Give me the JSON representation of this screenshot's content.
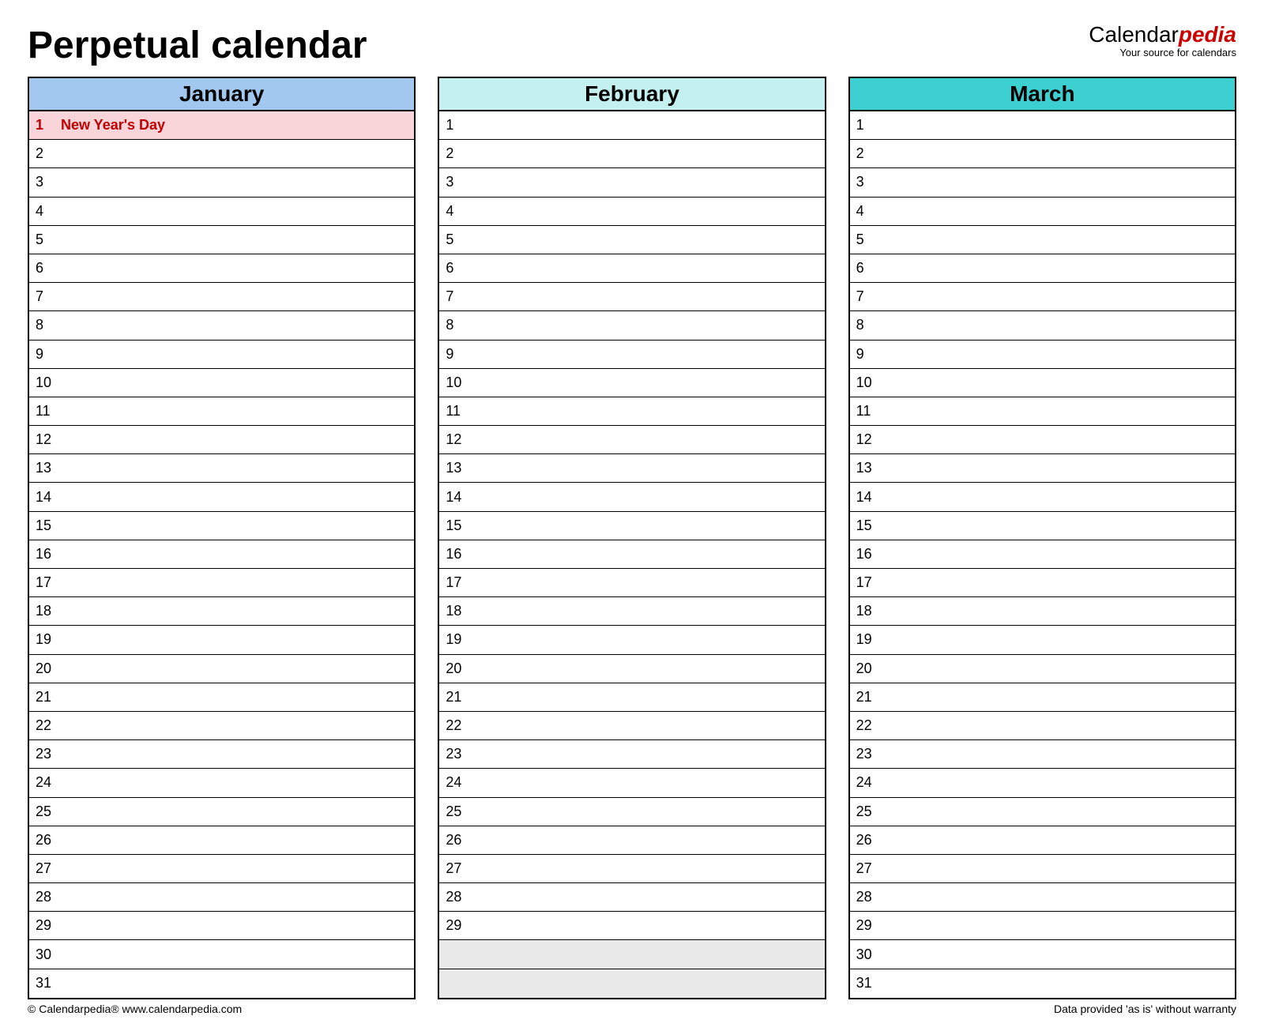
{
  "title": "Perpetual calendar",
  "brand": {
    "prefix": "Calendar",
    "suffix": "pedia",
    "tagline": "Your source for calendars"
  },
  "colors": {
    "january": "#a3c8f0",
    "february": "#c5f0f0",
    "march": "#3dd0d0",
    "holiday_bg": "#f9d4d9",
    "holiday_fg": "#c00000",
    "blank": "#e9e9e9"
  },
  "months": [
    {
      "name": "January",
      "header_color": "january",
      "days": 31,
      "holidays": {
        "1": "New Year's Day"
      }
    },
    {
      "name": "February",
      "header_color": "february",
      "days": 29,
      "blank_after": 31,
      "holidays": {}
    },
    {
      "name": "March",
      "header_color": "march",
      "days": 31,
      "holidays": {}
    }
  ],
  "max_rows": 31,
  "footer": {
    "left": "© Calendarpedia®   www.calendarpedia.com",
    "right": "Data provided 'as is' without warranty"
  }
}
